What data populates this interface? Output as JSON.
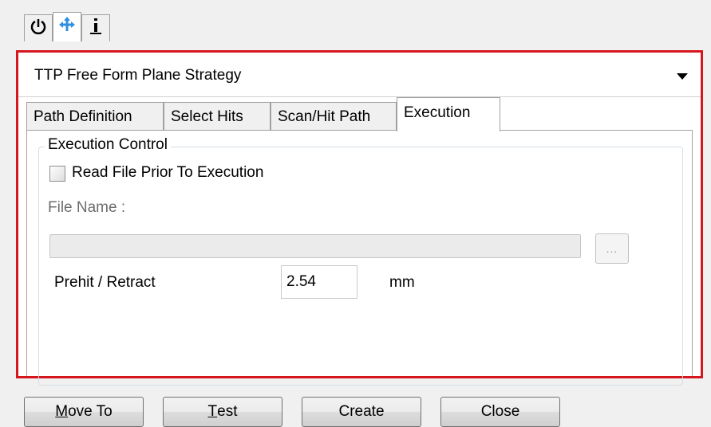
{
  "top_tabs": [
    {
      "icon": "power-icon"
    },
    {
      "icon": "move-arrows-icon"
    },
    {
      "icon": "info-icon"
    }
  ],
  "strategy": {
    "selected": "TTP Free Form Plane Strategy"
  },
  "tabs": [
    {
      "label": "Path Definition"
    },
    {
      "label": "Select Hits"
    },
    {
      "label": "Scan/Hit Path"
    },
    {
      "label": "Execution"
    }
  ],
  "execution": {
    "group_title": "Execution Control",
    "read_file_label": "Read File Prior To Execution",
    "read_file_checked": false,
    "file_name_label": "File Name :",
    "file_name_value": "",
    "browse_label": "...",
    "prehit_label": "Prehit / Retract",
    "prehit_value": "2.54",
    "prehit_unit": "mm"
  },
  "buttons": {
    "move_to_hotkey": "M",
    "move_to_rest": "ove To",
    "test_hotkey": "T",
    "test_rest": "est",
    "create": "Create",
    "close": "Close"
  },
  "colors": {
    "highlight_border": "#d6161d",
    "move_icon": "#2f8fe0"
  }
}
